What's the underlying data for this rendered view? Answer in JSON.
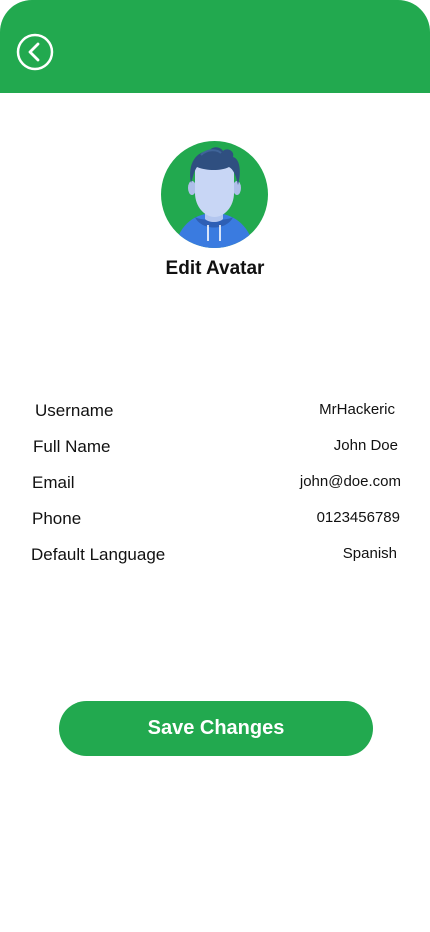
{
  "header": {
    "back_icon": "back-arrow-circle-icon",
    "accent_color": "#22a94f"
  },
  "avatar": {
    "edit_label": "Edit Avatar",
    "avatar_icon": "user-avatar-icon"
  },
  "profile": {
    "fields": [
      {
        "label": "Username",
        "value": "MrHackeric"
      },
      {
        "label": "Full Name",
        "value": "John Doe"
      },
      {
        "label": "Email",
        "value": "john@doe.com"
      },
      {
        "label": "Phone",
        "value": "0123456789"
      },
      {
        "label": "Default Language",
        "value": "Spanish"
      }
    ]
  },
  "actions": {
    "save_label": "Save Changes"
  }
}
